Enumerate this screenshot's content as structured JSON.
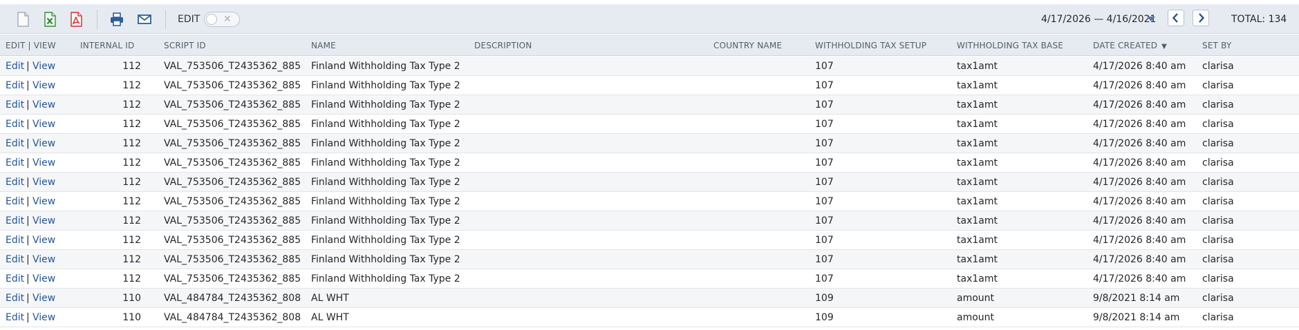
{
  "toolbar": {
    "edit_label": "EDIT",
    "date_range": "4/17/2026 — 4/16/2021",
    "total": "TOTAL: 134",
    "icons": [
      "new-document-icon",
      "export-excel-icon",
      "export-pdf-icon",
      "print-icon",
      "email-icon"
    ],
    "colors": {
      "excel": "#2e8b3a",
      "pdf": "#d52b2b",
      "print": "#2e5e9a",
      "email": "#2e5e9a",
      "link": "#255599"
    }
  },
  "columns": {
    "edit_view": "EDIT | VIEW",
    "internal_id": "INTERNAL ID",
    "script_id": "SCRIPT ID",
    "name": "NAME",
    "description": "DESCRIPTION",
    "country_name": "COUNTRY NAME",
    "wht_setup": "WITHHOLDING TAX SETUP",
    "wht_base": "WITHHOLDING TAX BASE",
    "date_created": "DATE CREATED",
    "set_by": "SET BY"
  },
  "row_labels": {
    "edit": "Edit",
    "separator": "|",
    "view": "View"
  },
  "rows": [
    {
      "internal_id": "112",
      "script_id": "VAL_753506_T2435362_885",
      "name": "Finland Withholding Tax Type 2",
      "description": "",
      "country_name": "",
      "wht_setup": "107",
      "wht_base": "tax1amt",
      "date_created": "4/17/2026 8:40 am",
      "set_by": "clarisa"
    },
    {
      "internal_id": "112",
      "script_id": "VAL_753506_T2435362_885",
      "name": "Finland Withholding Tax Type 2",
      "description": "",
      "country_name": "",
      "wht_setup": "107",
      "wht_base": "tax1amt",
      "date_created": "4/17/2026 8:40 am",
      "set_by": "clarisa"
    },
    {
      "internal_id": "112",
      "script_id": "VAL_753506_T2435362_885",
      "name": "Finland Withholding Tax Type 2",
      "description": "",
      "country_name": "",
      "wht_setup": "107",
      "wht_base": "tax1amt",
      "date_created": "4/17/2026 8:40 am",
      "set_by": "clarisa"
    },
    {
      "internal_id": "112",
      "script_id": "VAL_753506_T2435362_885",
      "name": "Finland Withholding Tax Type 2",
      "description": "",
      "country_name": "",
      "wht_setup": "107",
      "wht_base": "tax1amt",
      "date_created": "4/17/2026 8:40 am",
      "set_by": "clarisa"
    },
    {
      "internal_id": "112",
      "script_id": "VAL_753506_T2435362_885",
      "name": "Finland Withholding Tax Type 2",
      "description": "",
      "country_name": "",
      "wht_setup": "107",
      "wht_base": "tax1amt",
      "date_created": "4/17/2026 8:40 am",
      "set_by": "clarisa"
    },
    {
      "internal_id": "112",
      "script_id": "VAL_753506_T2435362_885",
      "name": "Finland Withholding Tax Type 2",
      "description": "",
      "country_name": "",
      "wht_setup": "107",
      "wht_base": "tax1amt",
      "date_created": "4/17/2026 8:40 am",
      "set_by": "clarisa"
    },
    {
      "internal_id": "112",
      "script_id": "VAL_753506_T2435362_885",
      "name": "Finland Withholding Tax Type 2",
      "description": "",
      "country_name": "",
      "wht_setup": "107",
      "wht_base": "tax1amt",
      "date_created": "4/17/2026 8:40 am",
      "set_by": "clarisa"
    },
    {
      "internal_id": "112",
      "script_id": "VAL_753506_T2435362_885",
      "name": "Finland Withholding Tax Type 2",
      "description": "",
      "country_name": "",
      "wht_setup": "107",
      "wht_base": "tax1amt",
      "date_created": "4/17/2026 8:40 am",
      "set_by": "clarisa"
    },
    {
      "internal_id": "112",
      "script_id": "VAL_753506_T2435362_885",
      "name": "Finland Withholding Tax Type 2",
      "description": "",
      "country_name": "",
      "wht_setup": "107",
      "wht_base": "tax1amt",
      "date_created": "4/17/2026 8:40 am",
      "set_by": "clarisa"
    },
    {
      "internal_id": "112",
      "script_id": "VAL_753506_T2435362_885",
      "name": "Finland Withholding Tax Type 2",
      "description": "",
      "country_name": "",
      "wht_setup": "107",
      "wht_base": "tax1amt",
      "date_created": "4/17/2026 8:40 am",
      "set_by": "clarisa"
    },
    {
      "internal_id": "112",
      "script_id": "VAL_753506_T2435362_885",
      "name": "Finland Withholding Tax Type 2",
      "description": "",
      "country_name": "",
      "wht_setup": "107",
      "wht_base": "tax1amt",
      "date_created": "4/17/2026 8:40 am",
      "set_by": "clarisa"
    },
    {
      "internal_id": "112",
      "script_id": "VAL_753506_T2435362_885",
      "name": "Finland Withholding Tax Type 2",
      "description": "",
      "country_name": "",
      "wht_setup": "107",
      "wht_base": "tax1amt",
      "date_created": "4/17/2026 8:40 am",
      "set_by": "clarisa"
    },
    {
      "internal_id": "110",
      "script_id": "VAL_484784_T2435362_808",
      "name": "AL WHT",
      "description": "",
      "country_name": "",
      "wht_setup": "109",
      "wht_base": "amount",
      "date_created": "9/8/2021 8:14 am",
      "set_by": "clarisa"
    },
    {
      "internal_id": "110",
      "script_id": "VAL_484784_T2435362_808",
      "name": "AL WHT",
      "description": "",
      "country_name": "",
      "wht_setup": "109",
      "wht_base": "amount",
      "date_created": "9/8/2021 8:14 am",
      "set_by": "clarisa"
    }
  ]
}
